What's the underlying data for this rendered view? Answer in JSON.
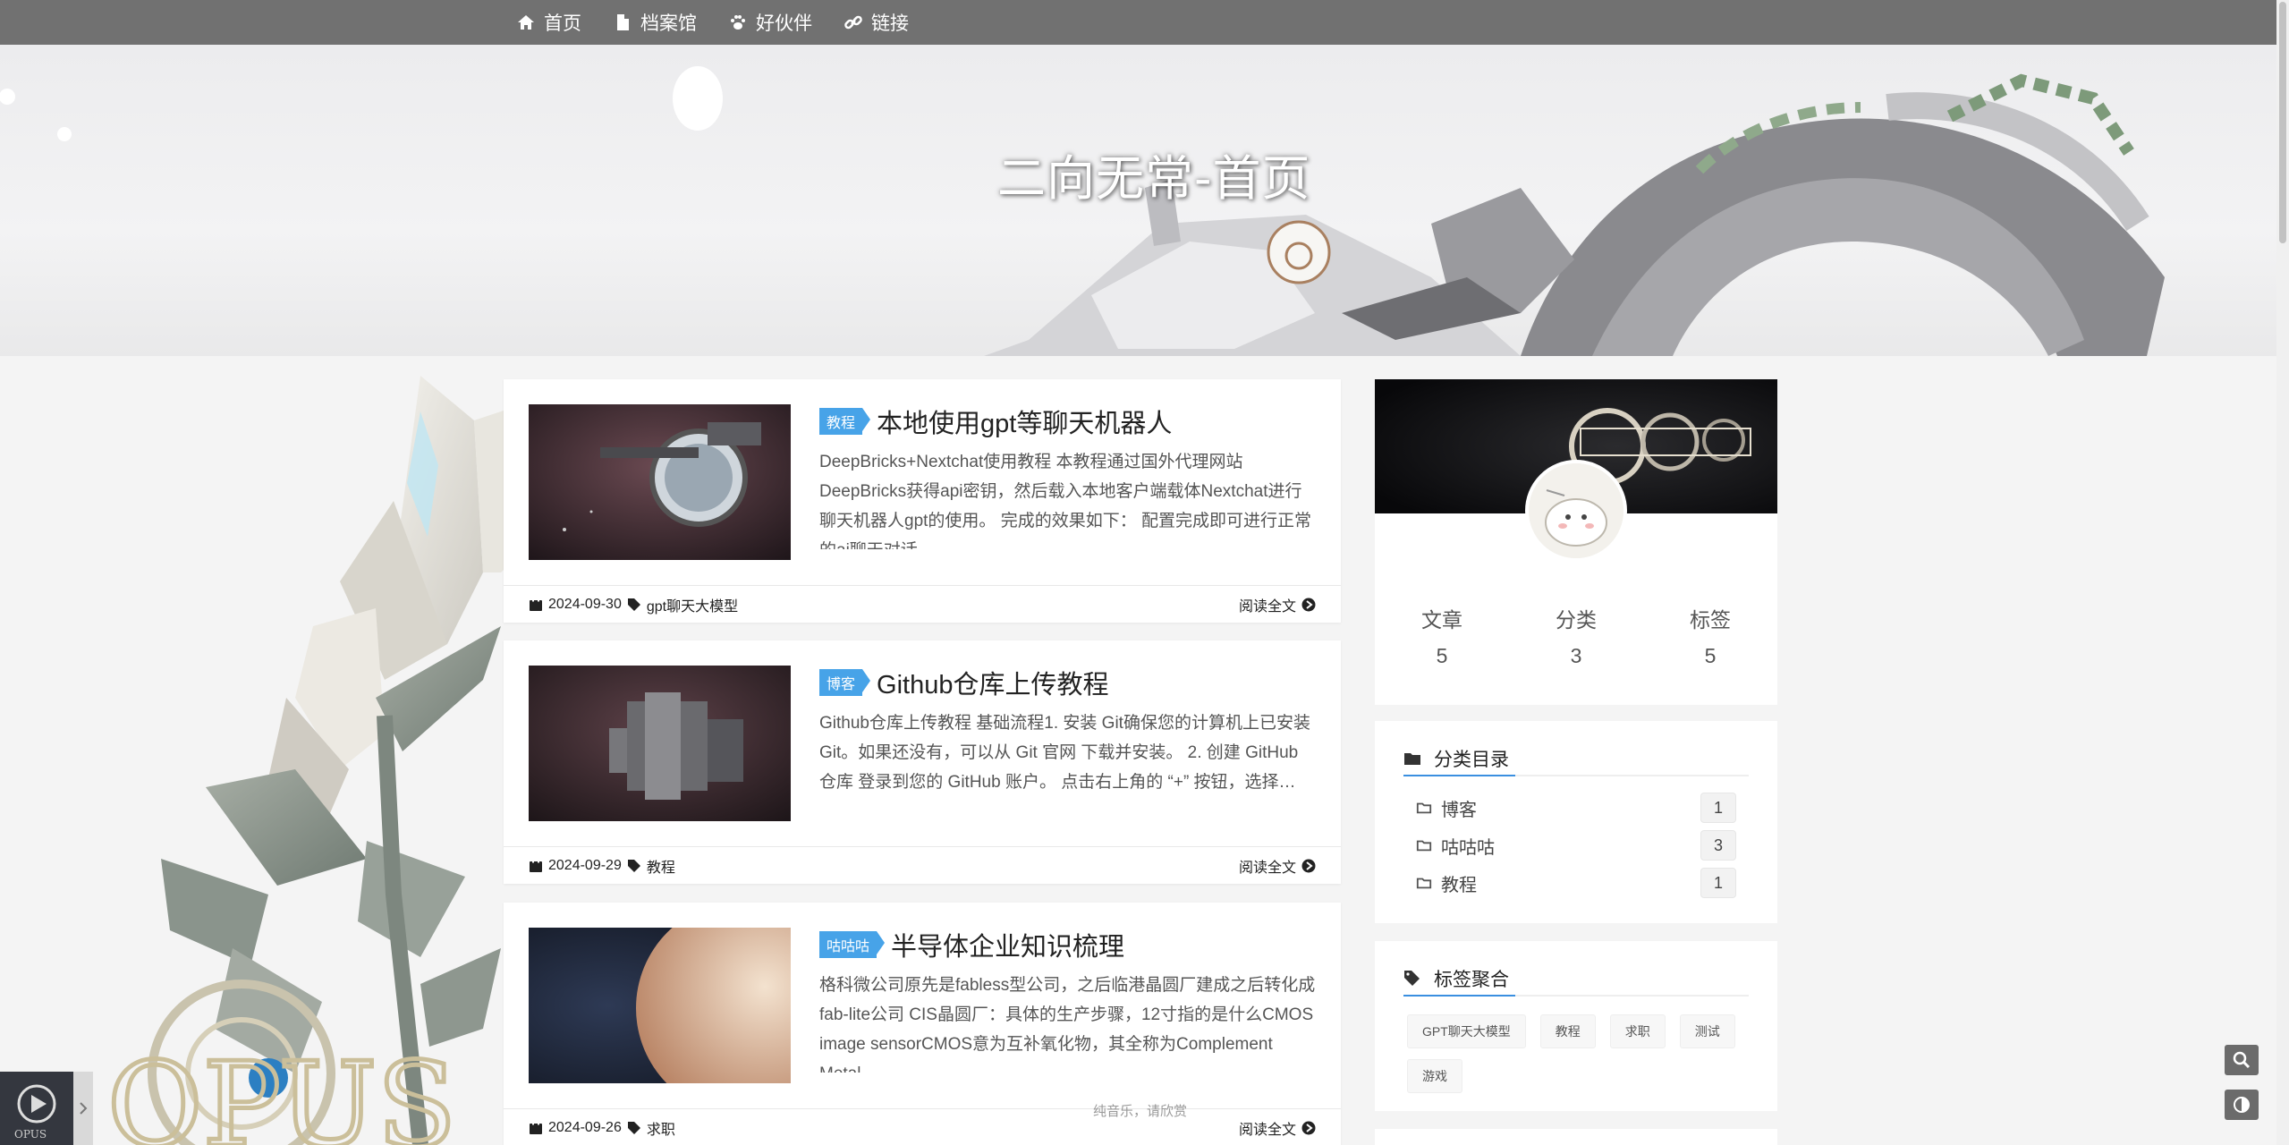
{
  "nav": {
    "items": [
      {
        "label": "首页",
        "icon": "home-icon"
      },
      {
        "label": "档案馆",
        "icon": "file-icon"
      },
      {
        "label": "好伙伴",
        "icon": "paw-icon"
      },
      {
        "label": "链接",
        "icon": "link-icon"
      }
    ]
  },
  "hero": {
    "title": "二向无常-首页"
  },
  "posts": [
    {
      "badge": "教程",
      "title": "本地使用gpt等聊天机器人",
      "excerpt": "DeepBricks+Nextchat使用教程 本教程通过国外代理网站DeepBricks获得api密钥，然后载入本地客户端载体Nextchat进行聊天机器人gpt的使用。 完成的效果如下： 配置完成即可进行正常的ai聊天对话。",
      "date": "2024-09-30",
      "tag": "gpt聊天大模型",
      "read_more": "阅读全文"
    },
    {
      "badge": "博客",
      "title": "Github仓库上传教程",
      "excerpt": "Github仓库上传教程 基础流程1. 安装 Git确保您的计算机上已安装 Git。如果还没有，可以从 Git 官网 下载并安装。 2. 创建 GitHub 仓库 登录到您的 GitHub 账户。 点击右上角的 “+” 按钮，选择…",
      "date": "2024-09-29",
      "tag": "教程",
      "read_more": "阅读全文"
    },
    {
      "badge": "咕咕咕",
      "title": "半导体企业知识梳理",
      "excerpt": "格科微公司原先是fabless型公司，之后临港晶圆厂建成之后转化成fab-lite公司 CIS晶圆厂：具体的生产步骤，12寸指的是什么CMOS image sensorCMOS意为互补氧化物，其全称为Complement Metal-",
      "date": "2024-09-26",
      "tag": "求职",
      "read_more": "阅读全文"
    }
  ],
  "profile": {
    "stats": [
      {
        "label": "文章",
        "value": "5"
      },
      {
        "label": "分类",
        "value": "3"
      },
      {
        "label": "标签",
        "value": "5"
      }
    ]
  },
  "categories": {
    "title": "分类目录",
    "items": [
      {
        "name": "博客",
        "count": "1"
      },
      {
        "name": "咕咕咕",
        "count": "3"
      },
      {
        "name": "教程",
        "count": "1"
      }
    ]
  },
  "tags": {
    "title": "标签聚合",
    "items": [
      "GPT聊天大模型",
      "教程",
      "求职",
      "测试",
      "游戏"
    ]
  },
  "music": {
    "tip": "纯音乐，请欣赏",
    "cover_text": "OPUS"
  },
  "colors": {
    "nav_bg": "#696969",
    "accent": "#47a3e8",
    "rule": "#3a8fe0"
  }
}
